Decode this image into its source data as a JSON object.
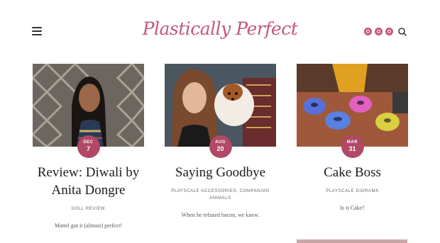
{
  "site": {
    "logo": "Plastically Perfect",
    "brand_color": "#c4577a",
    "badge_color": "#b04866"
  },
  "header": {
    "menu_icon": "hamburger-icon",
    "social_icons": [
      "instagram-icon",
      "pinterest-icon",
      "flickr-icon"
    ],
    "search_icon": "search-icon"
  },
  "posts": [
    {
      "month": "DEC",
      "day": "7",
      "title": "Review: Diwali by Anita Dongre",
      "category": "DOLL REVIEW",
      "excerpt": "Mattel got it (almost) perfect!"
    },
    {
      "month": "AUG",
      "day": "20",
      "title": "Saying Goodbye",
      "category": "PLAYSCALE ACCESSORIES, COMPANION ANIMALS",
      "excerpt": "When he refused bacon, we knew."
    },
    {
      "month": "MAR",
      "day": "31",
      "title": "Cake Boss",
      "category": "PLAYSCALE DIORAMA",
      "excerpt": "Is it Cake?"
    }
  ]
}
